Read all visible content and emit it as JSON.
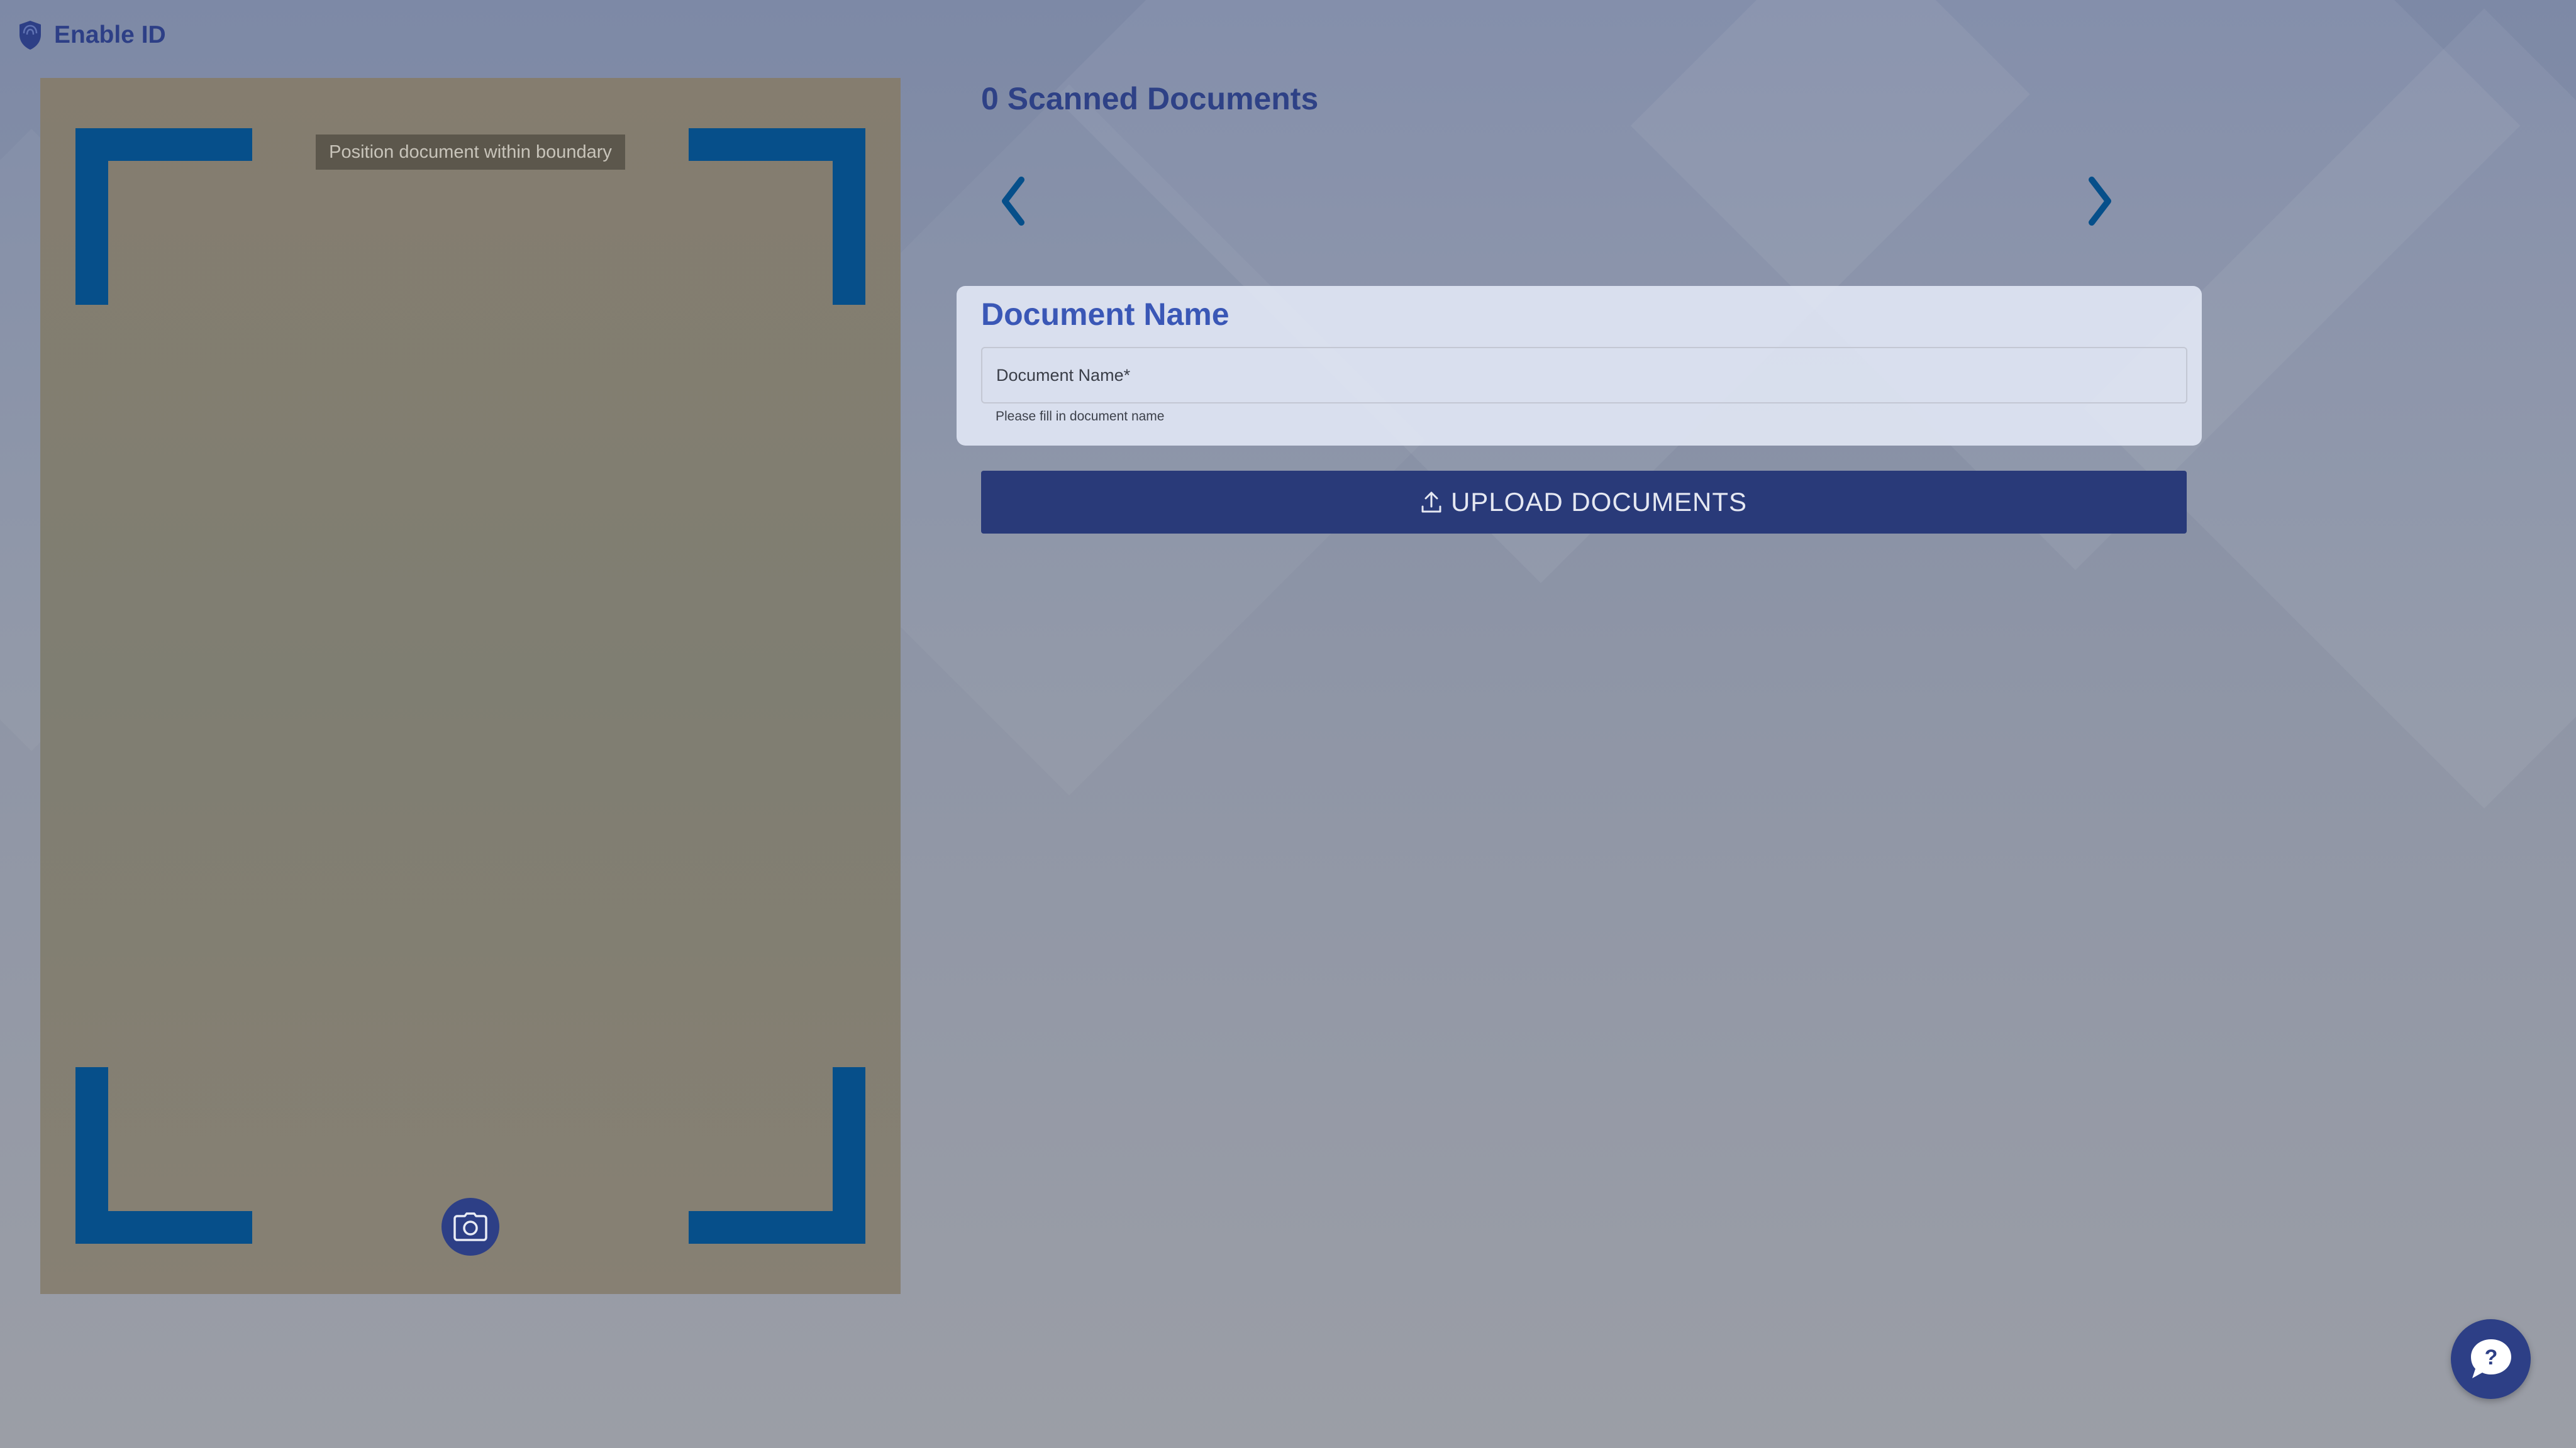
{
  "app": {
    "title": "Enable ID"
  },
  "scanner": {
    "hint": "Position document within boundary"
  },
  "scanned": {
    "title": "0 Scanned Documents"
  },
  "document_form": {
    "title": "Document Name",
    "field_label": "Document Name",
    "required_mark": "*",
    "helper_text": "Please fill in document name",
    "value": ""
  },
  "upload": {
    "label": "UPLOAD DOCUMENTS"
  },
  "icons": {
    "logo": "shield-icon",
    "prev": "chevron-left-icon",
    "next": "chevron-right-icon",
    "capture": "camera-icon",
    "upload": "upload-icon",
    "help": "help-chat-icon"
  },
  "colors": {
    "brand": "#2d3f86",
    "corner": "#064f8a",
    "card_title": "#3a57b6",
    "button": "#293a79"
  }
}
